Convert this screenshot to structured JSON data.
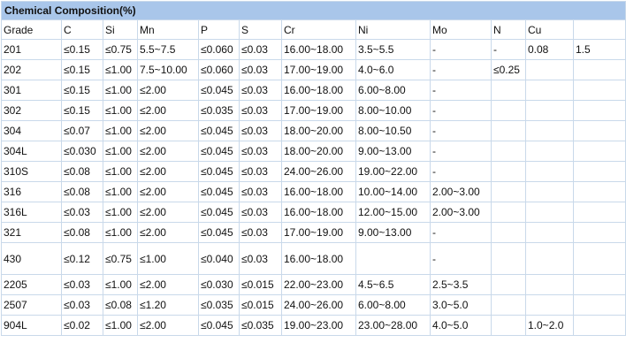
{
  "title": "Chemical Composition(%)",
  "headers": [
    "Grade",
    "C",
    "Si",
    "Mn",
    "P",
    "S",
    "Cr",
    "Ni",
    "Mo",
    "N",
    "Cu",
    ""
  ],
  "rows": [
    [
      "201",
      "≤0.15",
      "≤0.75",
      "5.5~7.5",
      "≤0.060",
      "≤0.03",
      "16.00~18.00",
      "3.5~5.5",
      "-",
      "-",
      "0.08",
      "1.5"
    ],
    [
      "202",
      "≤0.15",
      "≤1.00",
      "7.5~10.00",
      "≤0.060",
      "≤0.03",
      "17.00~19.00",
      "4.0~6.0",
      "-",
      "≤0.25",
      "",
      ""
    ],
    [
      "301",
      "≤0.15",
      "≤1.00",
      "≤2.00",
      "≤0.045",
      "≤0.03",
      "16.00~18.00",
      "6.00~8.00",
      "-",
      "",
      "",
      ""
    ],
    [
      "302",
      "≤0.15",
      "≤1.00",
      "≤2.00",
      "≤0.035",
      "≤0.03",
      "17.00~19.00",
      "8.00~10.00",
      "-",
      "",
      "",
      ""
    ],
    [
      "304",
      "≤0.07",
      "≤1.00",
      "≤2.00",
      "≤0.045",
      "≤0.03",
      "18.00~20.00",
      "8.00~10.50",
      "-",
      "",
      "",
      ""
    ],
    [
      "304L",
      "≤0.030",
      "≤1.00",
      "≤2.00",
      "≤0.045",
      "≤0.03",
      "18.00~20.00",
      "9.00~13.00",
      "-",
      "",
      "",
      ""
    ],
    [
      "310S",
      "≤0.08",
      "≤1.00",
      "≤2.00",
      "≤0.045",
      "≤0.03",
      "24.00~26.00",
      "19.00~22.00",
      "-",
      "",
      "",
      ""
    ],
    [
      "316",
      "≤0.08",
      "≤1.00",
      "≤2.00",
      "≤0.045",
      "≤0.03",
      "16.00~18.00",
      "10.00~14.00",
      "2.00~3.00",
      "",
      "",
      ""
    ],
    [
      "316L",
      "≤0.03",
      "≤1.00",
      "≤2.00",
      "≤0.045",
      "≤0.03",
      "16.00~18.00",
      "12.00~15.00",
      "2.00~3.00",
      "",
      "",
      ""
    ],
    [
      "321",
      "≤0.08",
      "≤1.00",
      "≤2.00",
      "≤0.045",
      "≤0.03",
      "17.00~19.00",
      "9.00~13.00",
      "-",
      "",
      "",
      ""
    ],
    [
      "430",
      "≤0.12",
      "≤0.75",
      "≤1.00",
      "≤0.040",
      "≤0.03",
      "16.00~18.00",
      "",
      "-",
      "",
      "",
      ""
    ],
    [
      "2205",
      "≤0.03",
      "≤1.00",
      "≤2.00",
      "≤0.030",
      "≤0.015",
      "22.00~23.00",
      "4.5~6.5",
      "2.5~3.5",
      "",
      "",
      ""
    ],
    [
      "2507",
      "≤0.03",
      "≤0.08",
      "≤1.20",
      "≤0.035",
      "≤0.015",
      "24.00~26.00",
      "6.00~8.00",
      "3.0~5.0",
      "",
      "",
      ""
    ],
    [
      "904L",
      "≤0.02",
      "≤1.00",
      "≤2.00",
      "≤0.045",
      "≤0.035",
      "19.00~23.00",
      "23.00~28.00",
      "4.0~5.0",
      "",
      "1.0~2.0",
      ""
    ]
  ]
}
